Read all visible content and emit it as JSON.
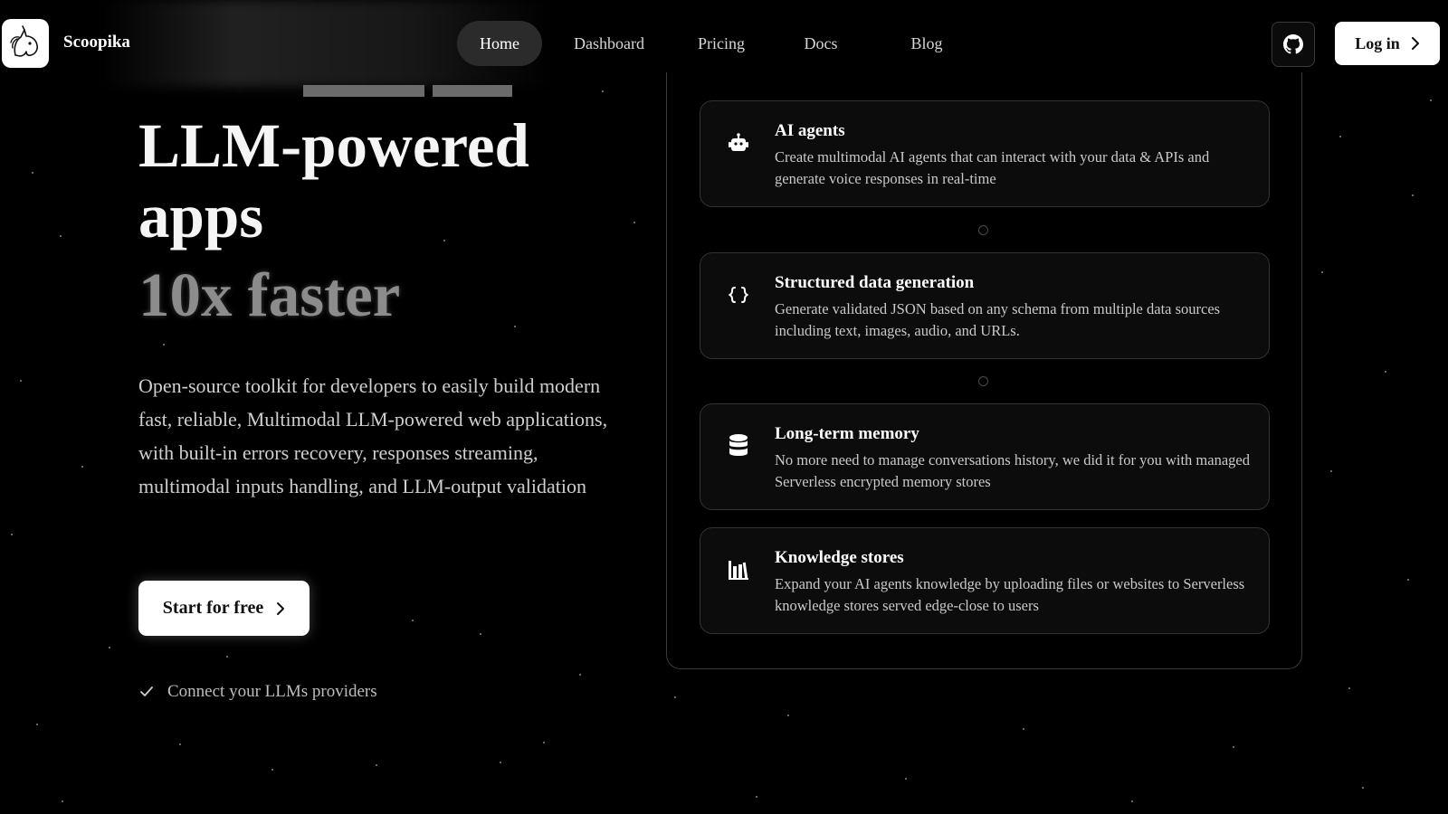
{
  "header": {
    "brand": "Scoopika",
    "logo_icon": "unicorn-logo-icon",
    "nav": [
      {
        "label": "Home",
        "active": true
      },
      {
        "label": "Dashboard",
        "active": false
      },
      {
        "label": "Pricing",
        "active": false
      },
      {
        "label": "Docs",
        "active": false
      },
      {
        "label": "Blog",
        "active": false
      }
    ],
    "github_icon": "github-icon",
    "login_label": "Log in"
  },
  "hero": {
    "title": "LLM-powered apps",
    "highlight": "10x faster",
    "description": "Open-source toolkit for developers to easily build modern fast, reliable, Multimodal LLM-powered web applications, with built-in errors recovery, responses streaming, multimodal inputs handling, and LLM-output validation",
    "cta_label": "Start for free",
    "check_item": "Connect your LLMs providers"
  },
  "features": [
    {
      "icon": "robot-icon",
      "title": "AI agents",
      "description": "Create multimodal AI agents that can interact with your data & APIs and generate voice responses in real-time"
    },
    {
      "icon": "braces-icon",
      "title": "Structured data generation",
      "description": "Generate validated JSON based on any schema from multiple data sources including text, images, audio, and URLs."
    },
    {
      "icon": "database-icon",
      "title": "Long-term memory",
      "description": "No more need to manage conversations history, we did it for you with managed Serverless encrypted memory stores"
    },
    {
      "icon": "library-icon",
      "title": "Knowledge stores",
      "description": "Expand your AI agents knowledge by uploading files or websites to Serverless knowledge stores served edge-close to users"
    }
  ],
  "colors": {
    "background": "#000000",
    "card_border": "#333333",
    "muted_text": "#8c8c8c"
  }
}
